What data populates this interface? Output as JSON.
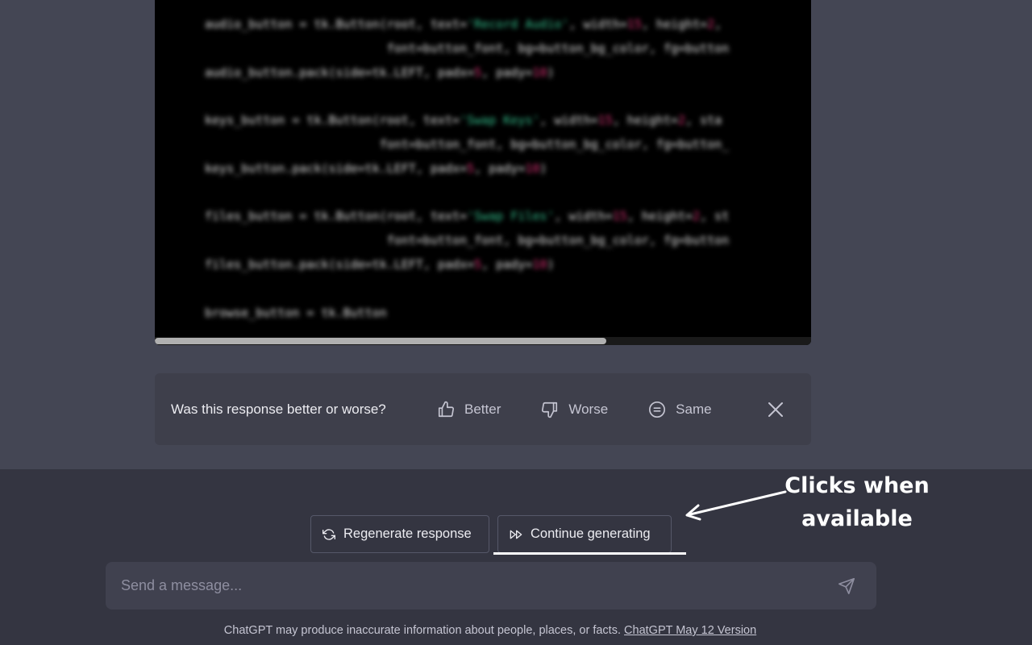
{
  "code": {
    "lines": [
      {
        "a": "audio_button = tk.Button(root, text=",
        "s": "'Record Audio'",
        "b": ", width=",
        "n": "15",
        "c": ", height=",
        "n2": "2",
        "d": ","
      },
      {
        "a": "                         font=button_font, bg=button_bg_color, fg=button",
        "s": "",
        "b": "",
        "n": "",
        "c": "",
        "n2": "",
        "d": ""
      },
      {
        "a": "audio_button.pack(side=tk.LEFT, padx=",
        "s": "",
        "b": "",
        "n": "5",
        "c": ", pady=",
        "n2": "10",
        "d": ")"
      },
      {
        "a": "",
        "s": "",
        "b": "",
        "n": "",
        "c": "",
        "n2": "",
        "d": ""
      },
      {
        "a": "keys_button = tk.Button(root, text=",
        "s": "'Swap Keys'",
        "b": ", width=",
        "n": "15",
        "c": ", height=",
        "n2": "2",
        "d": ", sta"
      },
      {
        "a": "                        font=button_font, bg=button_bg_color, fg=button_",
        "s": "",
        "b": "",
        "n": "",
        "c": "",
        "n2": "",
        "d": ""
      },
      {
        "a": "keys_button.pack(side=tk.LEFT, padx=",
        "s": "",
        "b": "",
        "n": "5",
        "c": ", pady=",
        "n2": "10",
        "d": ")"
      },
      {
        "a": "",
        "s": "",
        "b": "",
        "n": "",
        "c": "",
        "n2": "",
        "d": ""
      },
      {
        "a": "files_button = tk.Button(root, text=",
        "s": "'Swap Files'",
        "b": ", width=",
        "n": "15",
        "c": ", height=",
        "n2": "2",
        "d": ", st"
      },
      {
        "a": "                         font=button_font, bg=button_bg_color, fg=button",
        "s": "",
        "b": "",
        "n": "",
        "c": "",
        "n2": "",
        "d": ""
      },
      {
        "a": "files_button.pack(side=tk.LEFT, padx=",
        "s": "",
        "b": "",
        "n": "5",
        "c": ", pady=",
        "n2": "10",
        "d": ")"
      },
      {
        "a": "",
        "s": "",
        "b": "",
        "n": "",
        "c": "",
        "n2": "",
        "d": ""
      },
      {
        "a": "browse_button = tk.Button",
        "s": "",
        "b": "",
        "n": "",
        "c": "",
        "n2": "",
        "d": ""
      }
    ]
  },
  "feedback": {
    "question": "Was this response better or worse?",
    "better_label": "Better",
    "worse_label": "Worse",
    "same_label": "Same"
  },
  "actions": {
    "regenerate_label": "Regenerate response",
    "continue_label": "Continue generating"
  },
  "annotation": {
    "line1": "Clicks when",
    "line2": "available"
  },
  "composer": {
    "placeholder": "Send a message..."
  },
  "footer": {
    "disclaimer": "ChatGPT may produce inaccurate information about people, places, or facts.",
    "version_link": "ChatGPT May 12 Version"
  },
  "colors": {
    "chat_bg": "#444654",
    "bottom_bg": "#343541",
    "input_bg": "#40414f",
    "code_string": "#35c28f",
    "code_number": "#e0357a"
  }
}
